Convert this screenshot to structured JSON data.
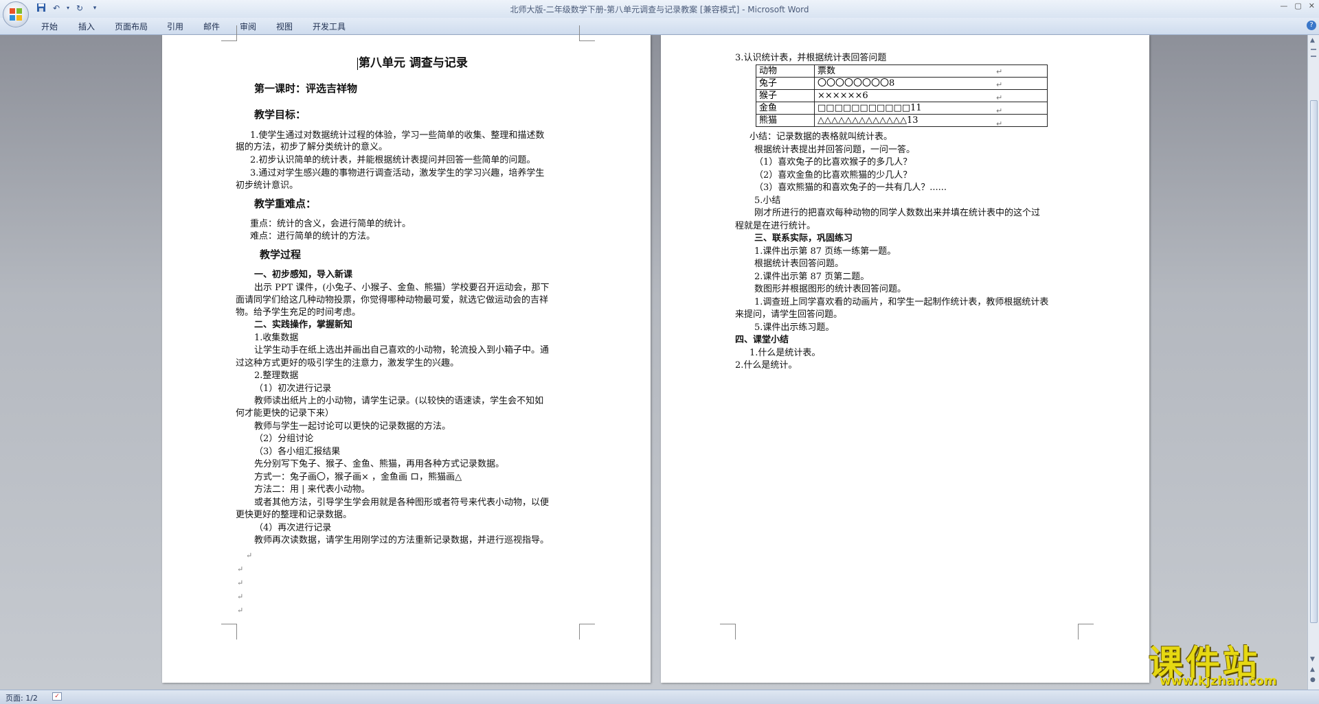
{
  "window": {
    "title": "北师大版-二年级数学下册-第八单元调查与记录教案 [兼容模式] - Microsoft Word"
  },
  "ribbon": {
    "tabs": [
      "开始",
      "插入",
      "页面布局",
      "引用",
      "邮件",
      "审阅",
      "视图",
      "开发工具"
    ]
  },
  "icons": {
    "office": "office-logo-icon",
    "save": "save-icon",
    "undo": "undo-icon",
    "redo": "redo-icon",
    "customize": "chevron-down-icon",
    "help": "help-icon"
  },
  "status": {
    "page": "页面: 1/2"
  },
  "page1": {
    "lines": [
      "第八单元  调查与记录",
      "第一课时：评选吉祥物",
      "教学目标：",
      "1.使学生通过对数据统计过程的体验，学习一些简单的收集、整理和描述数",
      "据的方法，初步了解分类统计的意义。",
      "2.初步认识简单的统计表，并能根据统计表提问并回答一些简单的问题。",
      "3.通过对学生感兴趣的事物进行调查活动，激发学生的学习兴趣，培养学生",
      "初步统计意识。",
      "教学重难点：",
      "重点：统计的含义，会进行简单的统计。",
      "难点：进行简单的统计的方法。",
      "教学过程",
      "一、初步感知，导入新课",
      "出示 PPT 课件，(小兔子、小猴子、金鱼、熊猫）学校要召开运动会，那下",
      "面请同学们给这几种动物投票，你觉得哪种动物最可爱，就选它做运动会的吉祥",
      "物。给予学生充足的时间考虑。",
      "二、实践操作，掌握新知",
      "1.收集数据",
      "让学生动手在纸上选出并画出自己喜欢的小动物，轮流投入到小箱子中。通",
      "过这种方式更好的吸引学生的注意力，激发学生的兴趣。",
      "2.整理数据",
      "（1）初次进行记录",
      "教师读出纸片上的小动物，请学生记录。(以较快的语速读，学生会不知如",
      "何才能更快的记录下来）",
      "教师与学生一起讨论可以更快的记录数据的方法。",
      "（2）分组讨论",
      "（3）各小组汇报结果",
      "先分别写下兔子、猴子、金鱼、熊猫，再用各种方式记录数据。",
      "方式一：兔子画〇，猴子画×  ，金鱼画 ロ，熊猫画△",
      "方法二：用 | 来代表小动物。",
      "或者其他方法，引导学生学会用就是各种图形或者符号来代表小动物，以便",
      "更快更好的整理和记录数据。",
      "（4）再次进行记录",
      "教师再次读数据，请学生用刚学过的方法重新记录数据，并进行巡视指导。"
    ]
  },
  "page2": {
    "intro": "3.认识统计表，并根据统计表回答问题",
    "table": {
      "headers": [
        "动物",
        "票数"
      ],
      "rows": [
        [
          "兔子",
          "〇〇〇〇〇〇〇〇8"
        ],
        [
          "猴子",
          "××××××6"
        ],
        [
          "金鱼",
          "□□□□□□□□□□□11"
        ],
        [
          "熊猫",
          "△△△△△△△△△△△△△13"
        ]
      ]
    },
    "lines": [
      "小结：记录数据的表格就叫统计表。",
      "根据统计表提出并回答问题，一问一答。",
      "（1）喜欢兔子的比喜欢猴子的多几人？",
      "（2）喜欢金鱼的比喜欢熊猫的少几人？",
      "（3）喜欢熊猫的和喜欢兔子的一共有几人？......",
      "5.小结",
      "刚才所进行的把喜欢每种动物的同学人数数出来并填在统计表中的这个过",
      "程就是在进行统计。",
      "三、联系实际，巩固练习",
      "1.课件出示第 87 页练一练第一题。",
      "根据统计表回答问题。",
      "2.课件出示第 87 页第二题。",
      "数图形并根据图形的统计表回答问题。",
      "1.调查班上同学喜欢看的动画片，和学生一起制作统计表，教师根据统计表",
      "来提问，请学生回答问题。",
      "5.课件出示练习题。",
      "四、课堂小结",
      "1.什么是统计表。",
      "2.什么是统计。"
    ]
  },
  "watermark": {
    "name": "课件站",
    "url": "www.kjzhan.com"
  }
}
